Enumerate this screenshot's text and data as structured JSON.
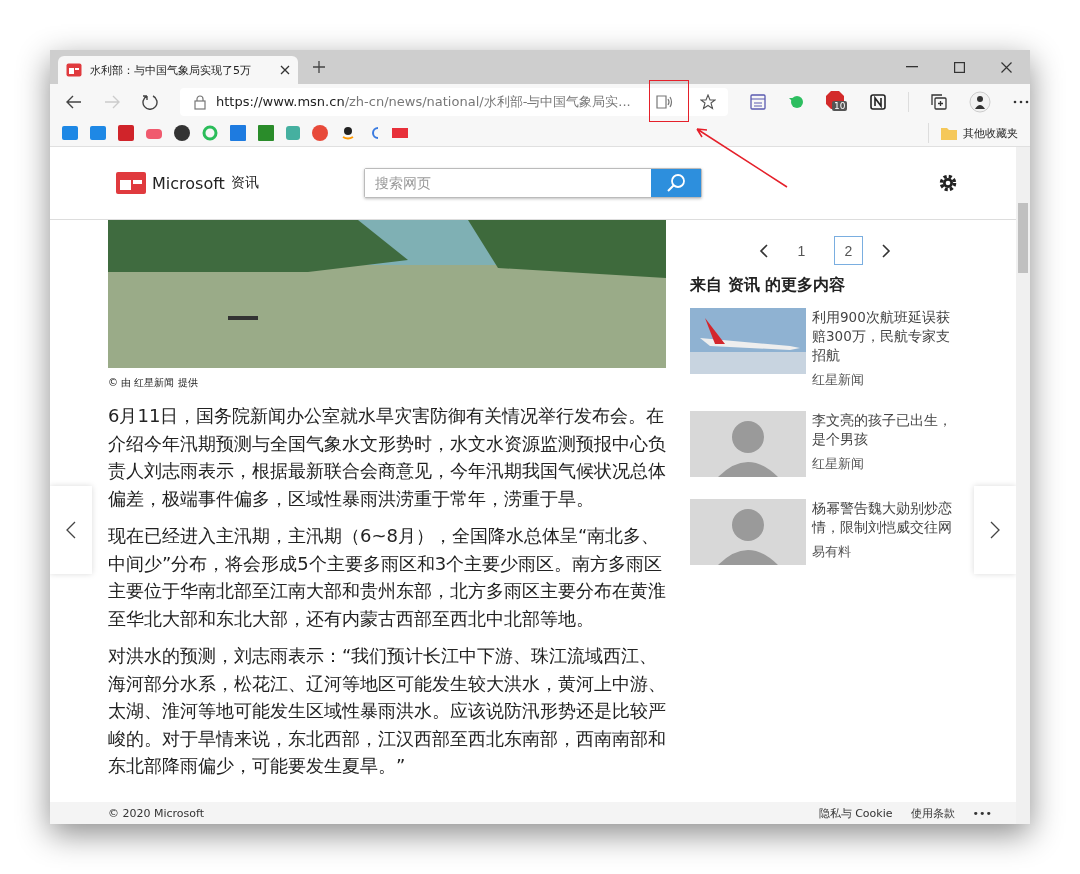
{
  "window": {
    "tab": {
      "title": "水利部：与中国气象局实现了5万",
      "selected": true
    }
  },
  "address_bar": {
    "url_host": "https://www.msn.cn",
    "url_path": "/zh-cn/news/national/水利部-与中国气象局实..."
  },
  "toolbar": {
    "badge": "10"
  },
  "bookmarks": {
    "folder": "其他收藏夹"
  },
  "site_header": {
    "brand": "Microsoft",
    "brand_suffix": "资讯",
    "search": {
      "placeholder": "搜索网页"
    }
  },
  "article": {
    "photo_credit": "© 由 红星新闻 提供",
    "paragraphs": [
      "6月11日，国务院新闻办公室就水旱灾害防御有关情况举行发布会。在介绍今年汛期预测与全国气象水文形势时，水文水资源监测预报中心负责人刘志雨表示，根据最新联合会商意见，今年汛期我国气候状况总体偏差，极端事件偏多，区域性暴雨洪涝重于常年，涝重于旱。",
      "现在已经进入主汛期，主汛期（6~8月），全国降水总体呈“南北多、中间少”分布，将会形成5个主要多雨区和3个主要少雨区。南方多雨区主要位于华南北部至江南大部和贵州东部，北方多雨区主要分布在黄淮至华北大部和东北大部，还有内蒙古西部至西北中北部等地。",
      "对洪水的预测，刘志雨表示：“我们预计长江中下游、珠江流域西江、海河部分水系，松花江、辽河等地区可能发生较大洪水，黄河上中游、太湖、淮河等地可能发生区域性暴雨洪水。应该说防汛形势还是比较严峻的。对于旱情来说，东北西部，江汉西部至西北东南部，西南南部和东北部降雨偏少，可能要发生夏旱。”"
    ]
  },
  "pager": [
    {
      "label": "1",
      "selected": false
    },
    {
      "label": "2",
      "selected": true
    }
  ],
  "more": {
    "heading": "来自 资讯 的更多内容",
    "items": [
      {
        "kind": "plane",
        "title": "利用900次航班延误获赔300万，民航专家支招航",
        "source": "红星新闻"
      },
      {
        "kind": "person",
        "title": "李文亮的孩子已出生，是个男孩",
        "source": "红星新闻"
      },
      {
        "kind": "person",
        "title": "杨幂警告魏大勋别炒恋情，限制刘恺威交往网",
        "source": "易有料"
      }
    ]
  },
  "footer": {
    "copyright": "© 2020 Microsoft",
    "links": [
      "隐私与 Cookie",
      "使用条款"
    ],
    "more": "•••"
  }
}
